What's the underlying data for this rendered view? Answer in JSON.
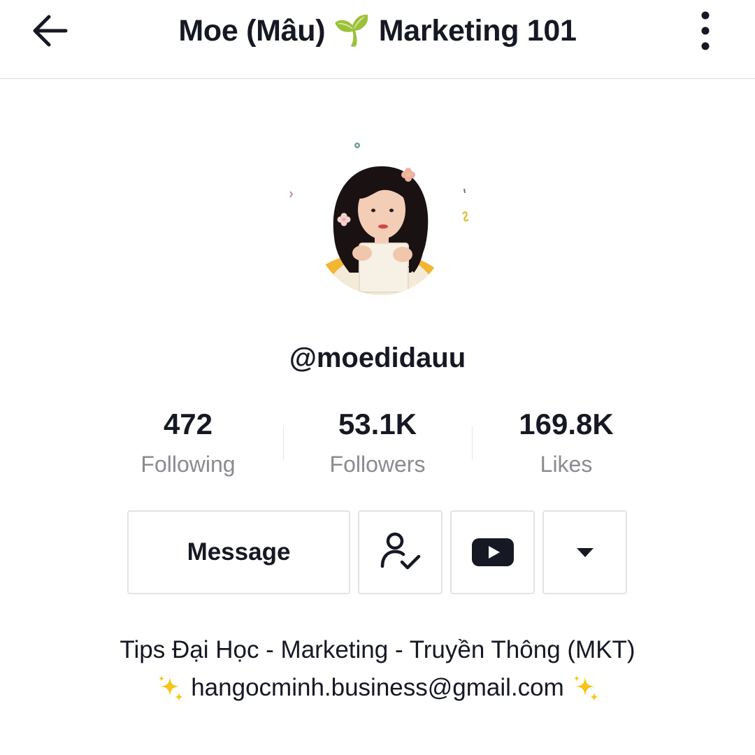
{
  "header": {
    "title": "Moe (Mâu) 🌱 Marketing 101",
    "back_icon": "arrow-left-icon",
    "more_icon": "vertical-dots-icon"
  },
  "profile": {
    "handle": "@moedidauu",
    "avatar_icon": "profile-avatar"
  },
  "stats": [
    {
      "value": "472",
      "label": "Following"
    },
    {
      "value": "53.1K",
      "label": "Followers"
    },
    {
      "value": "169.8K",
      "label": "Likes"
    }
  ],
  "actions": {
    "message_label": "Message",
    "follow_icon": "user-check-icon",
    "youtube_icon": "youtube-icon",
    "dropdown_icon": "caret-down-icon"
  },
  "bio": {
    "line1": "Tips Đại Học - Marketing - Truyền Thông (MKT)",
    "line2": "hangocminh.business@gmail.com",
    "sparkle_icon": "sparkles-icon"
  },
  "colors": {
    "text": "#161823",
    "secondary": "#8a8b91",
    "border": "#e3e3e4",
    "sparkle": "#f5c518"
  }
}
